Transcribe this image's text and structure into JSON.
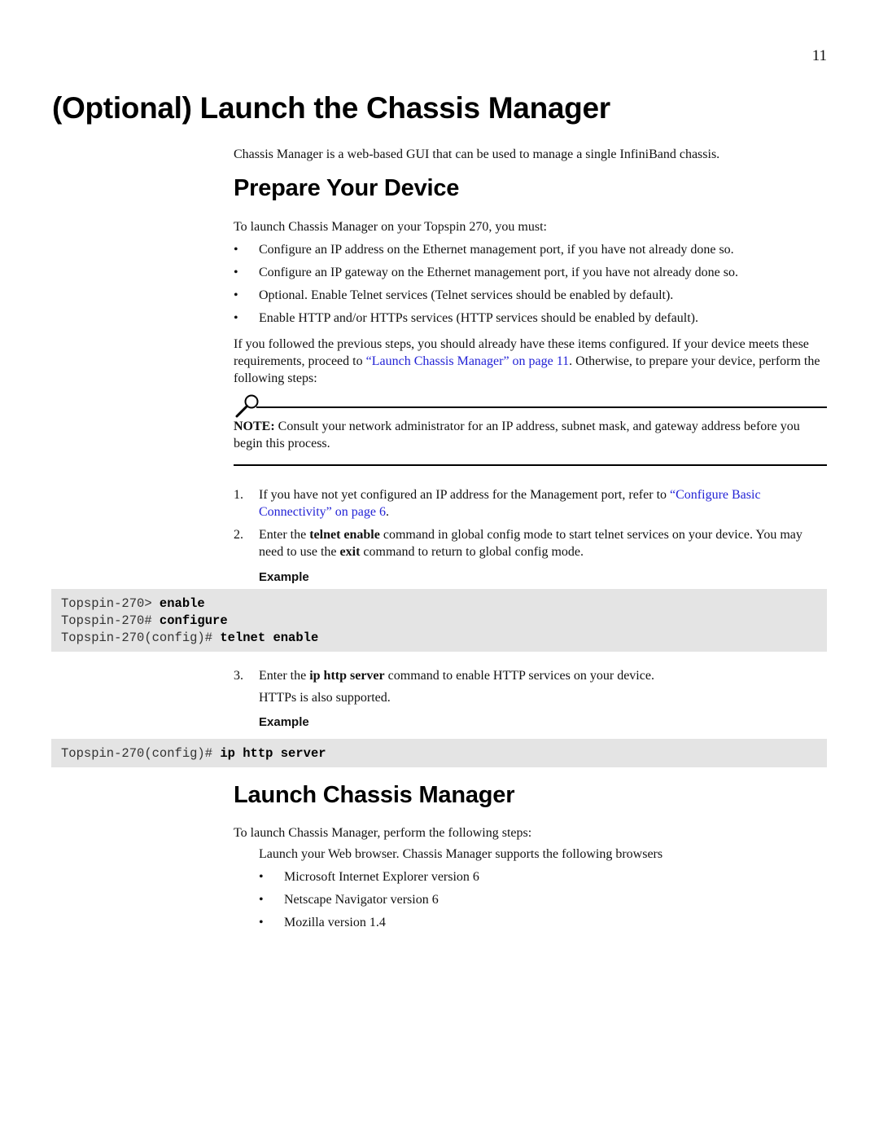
{
  "page_number": "11",
  "title": "(Optional) Launch the Chassis Manager",
  "intro": "Chassis Manager is a web-based GUI that can be used to manage a single InfiniBand chassis.",
  "prepare": {
    "heading": "Prepare Your Device",
    "lead": "To launch Chassis Manager on your Topspin 270, you must:",
    "bullet_glyph": "•",
    "bullets": [
      "Configure an IP address on the Ethernet management port, if you have not already done so.",
      "Configure an IP gateway on the Ethernet management port, if you have not already done so.",
      "Optional. Enable Telnet services (Telnet services should be enabled by default).",
      "Enable HTTP and/or HTTPs services (HTTP services should be enabled by default)."
    ],
    "para_before_link": "If you followed the previous steps, you should already have these items configured. If your device meets these requirements, proceed to ",
    "para_link": "“Launch Chassis Manager” on page 11",
    "para_after_link": ". Otherwise, to prepare your device, perform the following steps:",
    "note": {
      "icon": "magnifier-icon",
      "label": "NOTE:",
      "text": " Consult your network administrator for an IP address, subnet mask, and gateway address before you begin this process."
    },
    "steps": [
      {
        "num": "1.",
        "before": "If you have not yet configured an IP address for the Management port, refer to ",
        "link": "“Configure Basic Connectivity” on page 6",
        "after": "."
      },
      {
        "num": "2.",
        "t1": "Enter the ",
        "b1": "telnet enable",
        "t2": " command in global config mode to start telnet services on your device. You may need to use the ",
        "b2": "exit",
        "t3": " command to return to global config mode."
      },
      {
        "num": "3.",
        "t1": "Enter the ",
        "b1": "ip http server",
        "t2": " command to enable HTTP services on your device.",
        "line2": "HTTPs is also supported."
      }
    ],
    "example_label": "Example",
    "code1": [
      {
        "prompt": "Topspin-270> ",
        "cmd": "enable"
      },
      {
        "prompt": "Topspin-270# ",
        "cmd": "configure"
      },
      {
        "prompt": "Topspin-270(config)# ",
        "cmd": "telnet enable"
      }
    ],
    "code2": [
      {
        "prompt": "Topspin-270(config)# ",
        "cmd": "ip http server"
      }
    ]
  },
  "launch": {
    "heading": "Launch Chassis Manager",
    "lead": "To launch Chassis Manager, perform the following steps:",
    "step_text": "Launch your Web browser. Chassis Manager supports the following browsers",
    "browsers": [
      "Microsoft Internet Explorer version 6",
      "Netscape Navigator version 6",
      "Mozilla version 1.4"
    ]
  },
  "colors": {
    "link": "#2323d6",
    "code_background": "#e4e4e4"
  }
}
